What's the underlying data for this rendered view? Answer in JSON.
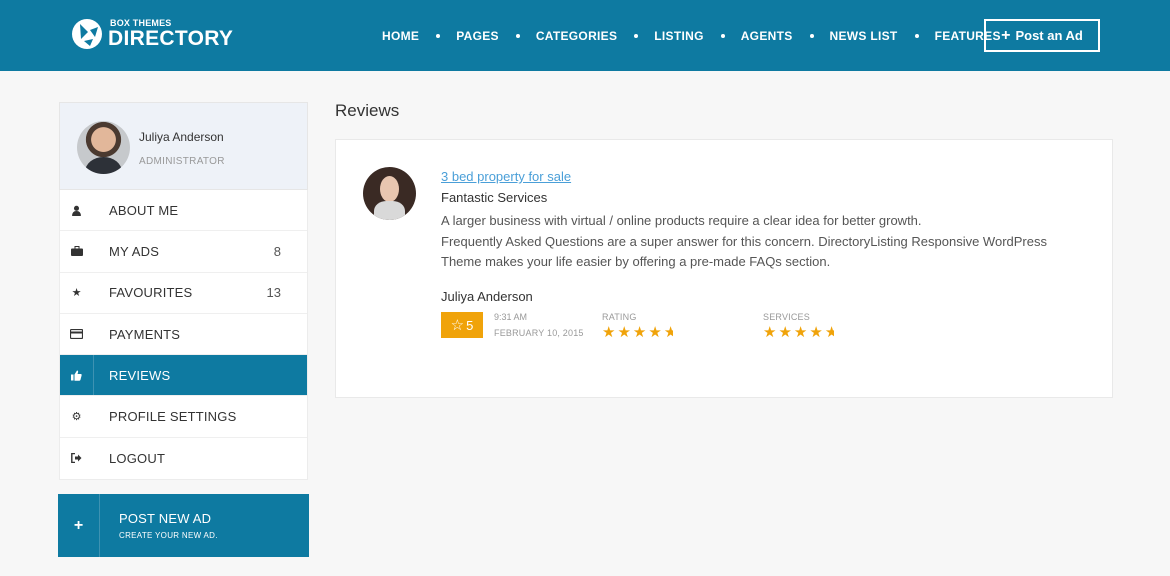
{
  "header": {
    "logo_small": "BOX THEMES",
    "logo_big": "DIRECTORY",
    "nav": [
      "HOME",
      "PAGES",
      "CATEGORIES",
      "LISTING",
      "AGENTS",
      "NEWS LIST",
      "FEATURES"
    ],
    "post_button": "Post an Ad",
    "accent_color": "#0e7aa1"
  },
  "sidebar": {
    "profile": {
      "name": "Juliya Anderson",
      "role": "ADMINISTRATOR"
    },
    "items": [
      {
        "label": "ABOUT ME",
        "icon": "user-icon",
        "count": ""
      },
      {
        "label": "MY ADS",
        "icon": "briefcase-icon",
        "count": "8"
      },
      {
        "label": "FAVOURITES",
        "icon": "star-icon",
        "count": "13"
      },
      {
        "label": "PAYMENTS",
        "icon": "credit-card-icon",
        "count": ""
      },
      {
        "label": "REVIEWS",
        "icon": "thumbs-up-icon",
        "count": "",
        "active": true
      },
      {
        "label": "PROFILE SETTINGS",
        "icon": "gear-icon",
        "count": ""
      },
      {
        "label": "LOGOUT",
        "icon": "sign-out-icon",
        "count": ""
      }
    ],
    "post_new": {
      "title": "POST NEW AD",
      "subtitle": "CREATE YOUR NEW AD."
    }
  },
  "main": {
    "title": "Reviews",
    "review": {
      "listing_link": "3 bed property for sale",
      "title": "Fantastic Services",
      "body_lines": [
        "A larger business with virtual / online products require a clear idea for better growth.",
        "Frequently Asked Questions are a super answer for this concern. DirectoryListing Responsive WordPress",
        "Theme makes your life easier by offering a pre-made FAQs section."
      ],
      "author": "Juliya Anderson",
      "score": "5",
      "time": "9:31 AM",
      "date": "FEBRUARY 10, 2015",
      "rating_label": "RATING",
      "rating_value": 4.5,
      "services_label": "SERVICES",
      "services_value": 4.5,
      "star_color": "#f0a30a"
    }
  }
}
